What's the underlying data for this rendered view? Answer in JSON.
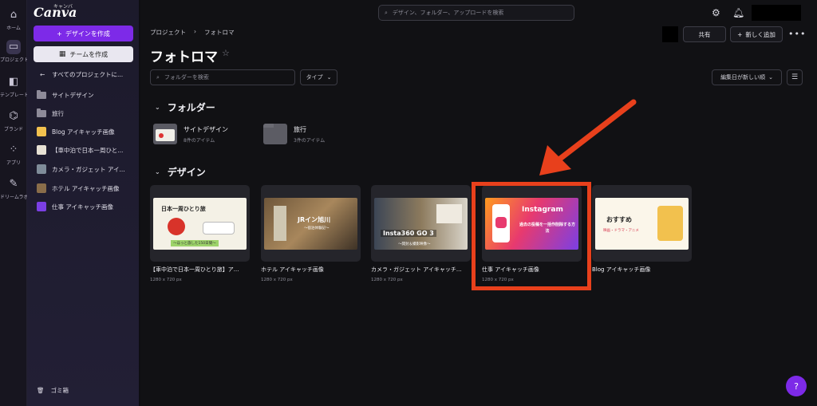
{
  "rail": {
    "items": [
      {
        "icon": "home-icon",
        "glyph": "⌂",
        "label": "ホーム"
      },
      {
        "icon": "projects-icon",
        "glyph": "▭",
        "label": "プロジェクト"
      },
      {
        "icon": "templates-icon",
        "glyph": "◧",
        "label": "テンプレート"
      },
      {
        "icon": "brand-icon",
        "glyph": "⌬",
        "label": "ブランド"
      },
      {
        "icon": "apps-icon",
        "glyph": "⁘",
        "label": "アプリ"
      },
      {
        "icon": "dream-lab-icon",
        "glyph": "✎",
        "label": "ドリームラボ"
      }
    ]
  },
  "sidebar": {
    "logo": "Canva",
    "logo_kana": "キャンバ",
    "create_design": "デザインを作成",
    "create_team": "チームを作成",
    "back_link": "すべてのプロジェクトに...",
    "items": [
      {
        "label": "サイトデザイン",
        "kind": "folder"
      },
      {
        "label": "旅行",
        "kind": "folder"
      },
      {
        "label": "Blog アイキャッチ画像",
        "kind": "design",
        "color": "#f2c14e"
      },
      {
        "label": "【車中泊で日本一周ひと...",
        "kind": "design",
        "color": "#e7e1d4"
      },
      {
        "label": "カメラ・ガジェット アイ...",
        "kind": "design",
        "color": "#7f8c99"
      },
      {
        "label": "ホテル アイキャッチ画像",
        "kind": "design",
        "color": "#8a6d4a"
      },
      {
        "label": "仕事 アイキャッチ画像",
        "kind": "design",
        "color": "#7b3fe4"
      }
    ],
    "trash": "ゴミ箱"
  },
  "header": {
    "search_placeholder": "デザイン、フォルダー、アップロードを検索",
    "share": "共有",
    "add_new": "新しく追加",
    "more": "•••"
  },
  "page": {
    "breadcrumb": [
      "プロジェクト",
      "フォトロマ"
    ],
    "title": "フォトロマ",
    "folder_search_placeholder": "フォルダーを検索",
    "type_filter": "タイプ",
    "sort": "編集日が新しい順"
  },
  "folders_section": {
    "heading": "フォルダー",
    "items": [
      {
        "name": "サイトデザイン",
        "count": "8件のアイテム"
      },
      {
        "name": "旅行",
        "count": "3件のアイテム"
      }
    ]
  },
  "designs_section": {
    "heading": "デザイン",
    "items": [
      {
        "title": "【車中泊で日本一周ひとり旅】ア...",
        "size": "1280 x 720 px",
        "thumb_text": "日本一周ひとり旅",
        "thumb_sub": "〜ほっと旅した150日間〜"
      },
      {
        "title": "ホテル アイキャッチ画像",
        "size": "1280 x 720 px",
        "thumb_text": "JRイン旭川",
        "thumb_sub": "〜宿泊体験記〜"
      },
      {
        "title": "カメラ・ガジェット アイキャッチ...",
        "size": "1280 x 720 px",
        "thumb_text": "Insta360 GO 3",
        "thumb_sub": "〜開封＆撮影映像〜"
      },
      {
        "title": "仕事 アイキャッチ画像",
        "size": "1280 x 720 px",
        "thumb_text": "Instagram",
        "thumb_sub": "過去の投稿を一括作削除する方法"
      },
      {
        "title": "Blog アイキャッチ画像",
        "size": "",
        "thumb_text": "おすすめ",
        "thumb_sub": "映画・ドラマ・アニメ"
      }
    ]
  },
  "help": "?",
  "colors": {
    "accent": "#7d2ae8",
    "highlight": "#e8401c"
  }
}
